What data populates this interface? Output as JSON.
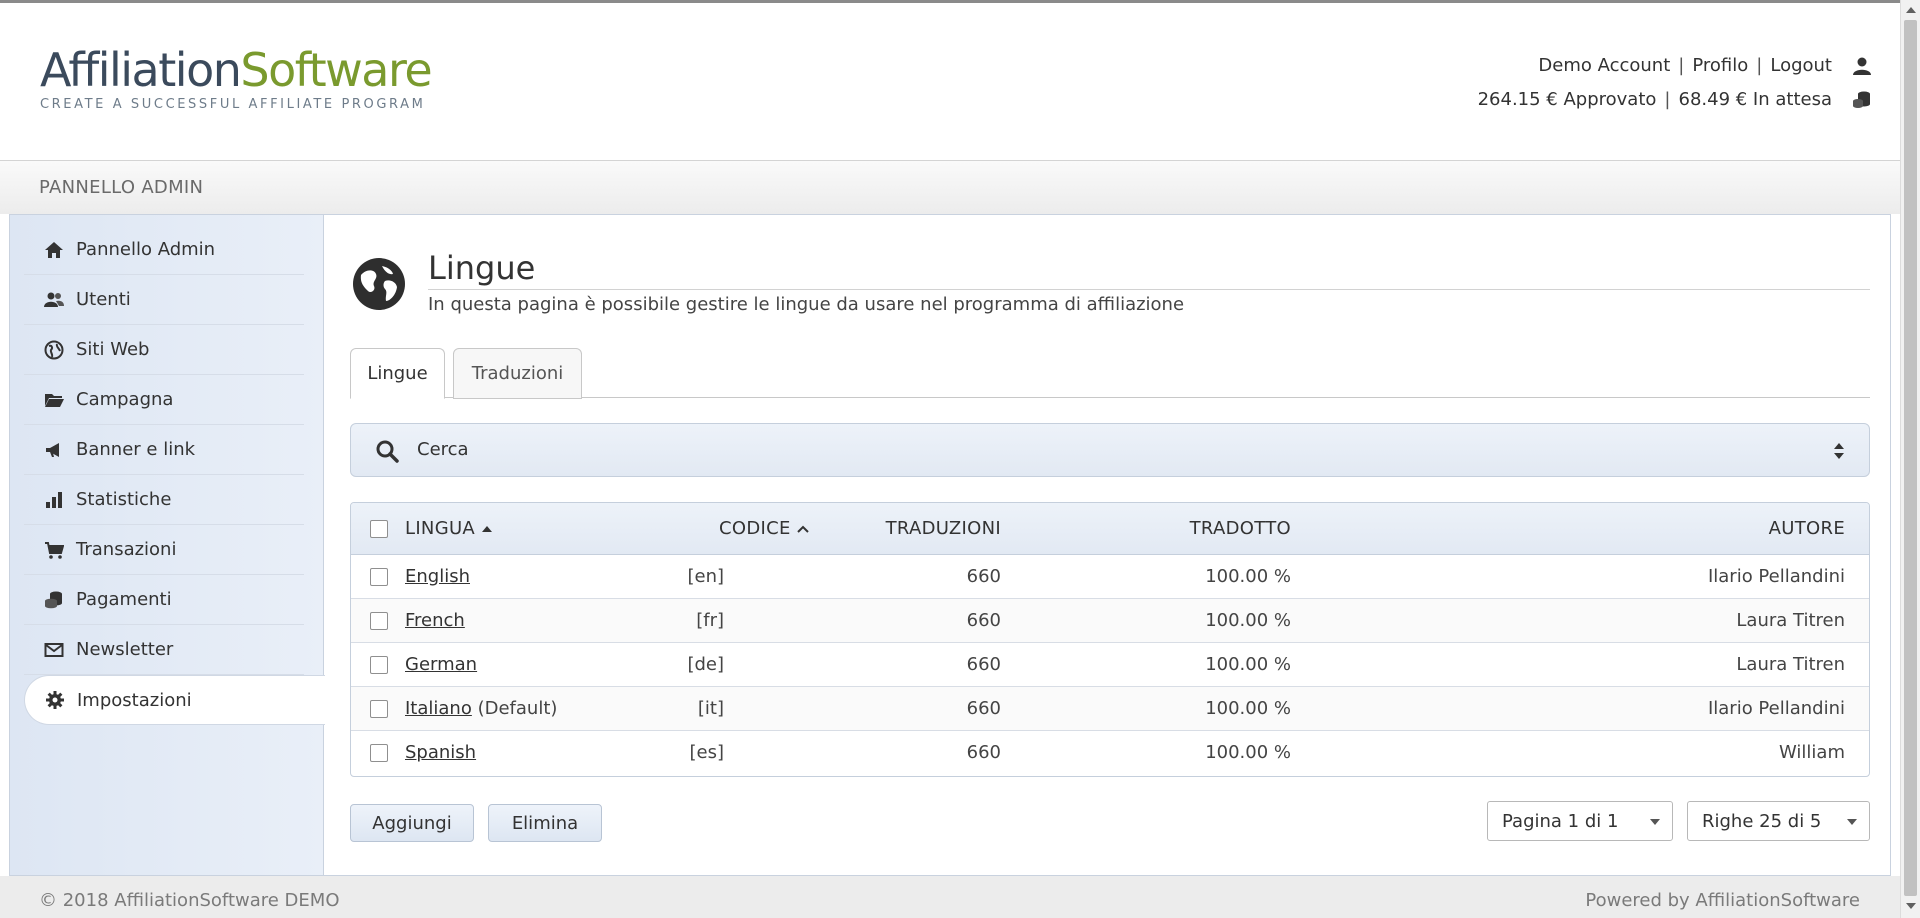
{
  "logo": {
    "part1": "Affiliation",
    "part2": "Software",
    "tagline": "CREATE A SUCCESSFUL AFFILIATE PROGRAM"
  },
  "user": {
    "account": "Demo Account",
    "profile": "Profilo",
    "logout": "Logout",
    "approved": "264.15 € Approvato",
    "pending": "68.49 € In attesa",
    "sep": "|"
  },
  "admin_bar": {
    "title": "PANNELLO ADMIN"
  },
  "sidebar": {
    "items": [
      {
        "label": "Pannello Admin",
        "icon": "home-icon"
      },
      {
        "label": "Utenti",
        "icon": "users-icon"
      },
      {
        "label": "Siti Web",
        "icon": "globe-icon"
      },
      {
        "label": "Campagna",
        "icon": "folder-icon"
      },
      {
        "label": "Banner e link",
        "icon": "megaphone-icon"
      },
      {
        "label": "Statistiche",
        "icon": "bar-chart-icon"
      },
      {
        "label": "Transazioni",
        "icon": "cart-icon"
      },
      {
        "label": "Pagamenti",
        "icon": "coins-icon"
      },
      {
        "label": "Newsletter",
        "icon": "envelope-icon"
      },
      {
        "label": "Impostazioni",
        "icon": "gear-icon",
        "active": true
      }
    ]
  },
  "page": {
    "title": "Lingue",
    "description": "In questa pagina è possibile gestire le lingue da usare nel programma di affiliazione"
  },
  "tabs": [
    {
      "label": "Lingue",
      "active": true
    },
    {
      "label": "Traduzioni"
    }
  ],
  "search": {
    "label": "Cerca"
  },
  "table": {
    "headers": {
      "lingua": "LINGUA",
      "codice": "CODICE",
      "traduzioni": "TRADUZIONI",
      "tradotto": "TRADOTTO",
      "autore": "AUTORE"
    },
    "rows": [
      {
        "lingua": "English",
        "extra": "",
        "codice": "[en]",
        "traduzioni": "660",
        "tradotto": "100.00 %",
        "autore": "Ilario Pellandini"
      },
      {
        "lingua": "French",
        "extra": "",
        "codice": "[fr]",
        "traduzioni": "660",
        "tradotto": "100.00 %",
        "autore": "Laura Titren"
      },
      {
        "lingua": "German",
        "extra": "",
        "codice": "[de]",
        "traduzioni": "660",
        "tradotto": "100.00 %",
        "autore": "Laura Titren"
      },
      {
        "lingua": "Italiano",
        "extra": "(Default)",
        "codice": "[it]",
        "traduzioni": "660",
        "tradotto": "100.00 %",
        "autore": "Ilario Pellandini"
      },
      {
        "lingua": "Spanish",
        "extra": "",
        "codice": "[es]",
        "traduzioni": "660",
        "tradotto": "100.00 %",
        "autore": "William"
      }
    ]
  },
  "actions": {
    "add": "Aggiungi",
    "delete": "Elimina"
  },
  "pagination": {
    "page": "Pagina 1 di 1",
    "rows": "Righe 25 di 5"
  },
  "footer": {
    "left": "© 2018 AffiliationSoftware DEMO",
    "right": "Powered by AffiliationSoftware"
  }
}
